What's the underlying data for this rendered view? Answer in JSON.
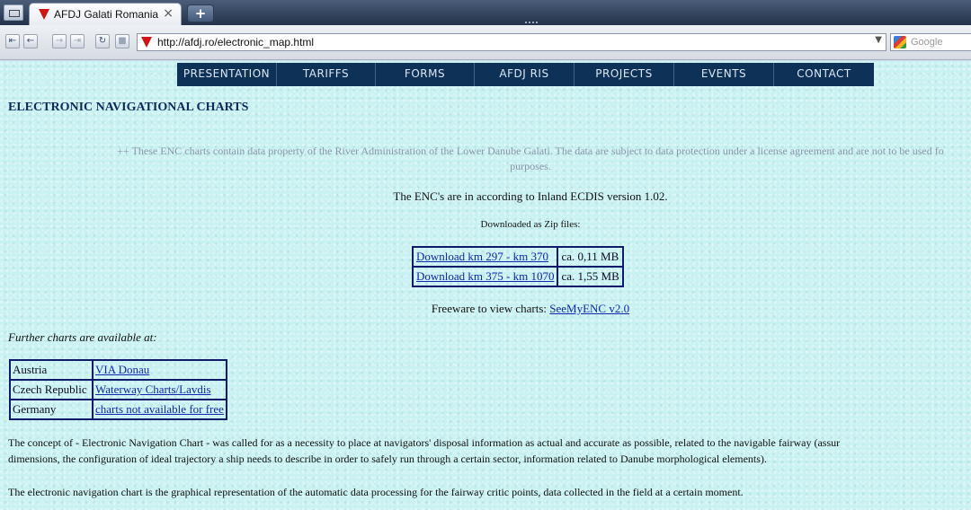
{
  "browser": {
    "tab_title": "AFDJ Galati Romania",
    "tab_close": "×",
    "new_tab": "+",
    "url": "http://afdj.ro/electronic_map.html",
    "search_placeholder": "Google"
  },
  "nav": {
    "items": [
      {
        "label": "PRESENTATION"
      },
      {
        "label": "TARIFFS"
      },
      {
        "label": "FORMS"
      },
      {
        "label": "AFDJ RIS"
      },
      {
        "label": "PROJECTS"
      },
      {
        "label": "EVENTS"
      },
      {
        "label": "CONTACT"
      }
    ]
  },
  "content": {
    "heading": "ELECTRONIC NAVIGATIONAL CHARTS",
    "notice_line1": "++ These ENC charts contain data property of the River Administration of the Lower Danube Galati. The data are subject to data protection under a license agreement and are not to be used fo",
    "notice_line2": "purposes.",
    "enc_version": "The ENC's are in according to Inland ECDIS version 1.02.",
    "zip_note": "Downloaded as Zip files:",
    "downloads": [
      {
        "link": "Download km 297 - km 370",
        "size": "ca. 0,11 MB"
      },
      {
        "link": "Download km 375 - km 1070",
        "size": "ca. 1,55 MB"
      }
    ],
    "freeware_text": "Freeware to view charts: ",
    "freeware_link": "SeeMyENC v2.0",
    "further": "Further charts are available at:",
    "charts": [
      {
        "country": "Austria",
        "link": "VIA Donau"
      },
      {
        "country": "Czech Republic",
        "link": "Waterway Charts/Lavdis"
      },
      {
        "country": "Germany",
        "link": "charts not available for free"
      }
    ],
    "para1_line1": "The concept of - Electronic Navigation Chart - was called for as a necessity to place at navigators' disposal information as actual and accurate as possible, related to the navigable fairway (assur",
    "para1_line2": "dimensions, the configuration of ideal trajectory a ship needs to describe in order to safely run through a certain sector, information related to Danube morphological elements).",
    "para2": "The electronic navigation chart is the graphical representation of the automatic data processing for the fairway critic points, data collected in the field at a certain moment."
  }
}
